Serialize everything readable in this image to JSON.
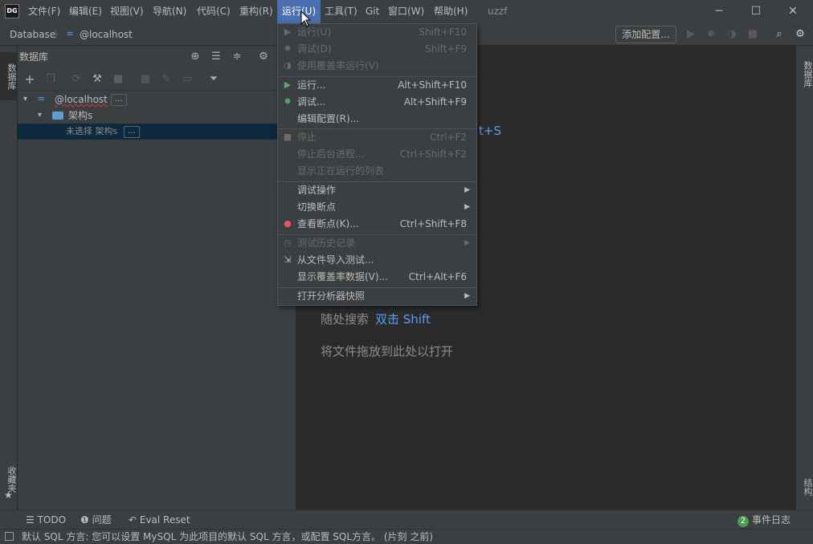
{
  "app": {
    "logo": "DG",
    "project": "uzzf"
  },
  "menu": [
    "文件(F)",
    "编辑(E)",
    "视图(V)",
    "导航(N)",
    "代码(C)",
    "重构(R)",
    "运行(U)",
    "工具(T)",
    "Git",
    "窗口(W)",
    "帮助(H)"
  ],
  "window_controls": {
    "minimize": "─",
    "maximize": "☐",
    "close": "✕"
  },
  "breadcrumb": {
    "root": "Database",
    "sep": "〉",
    "item": "@localhost"
  },
  "toolbar": {
    "add_config": "添加配置..."
  },
  "left_tabs": {
    "database": "数据库",
    "favorites": "收藏夹"
  },
  "right_tabs": {
    "database": "数据库",
    "structure": "结构"
  },
  "db_panel": {
    "title": "数据库"
  },
  "tree": {
    "host": "@localhost",
    "host_more": "...",
    "schemas": "架构s",
    "unselected": "未选择 架构s",
    "unselected_more": "..."
  },
  "editor": {
    "shortcut_fragment": "t+S",
    "search_label": "随处搜索",
    "search_key": "双击 Shift",
    "drop_label": "将文件拖放到此处以打开"
  },
  "run_menu": [
    {
      "label": "运行(U)",
      "shortcut": "Shift+F10",
      "disabled": true,
      "icon": "run-icon"
    },
    {
      "label": "调试(D)",
      "shortcut": "Shift+F9",
      "disabled": true,
      "icon": "debug-icon"
    },
    {
      "label": "使用覆盖率运行(V)",
      "shortcut": "",
      "disabled": true,
      "icon": "coverage-icon"
    },
    {
      "label": "运行...",
      "shortcut": "Alt+Shift+F10",
      "disabled": false,
      "icon": "run-icon"
    },
    {
      "label": "调试...",
      "shortcut": "Alt+Shift+F9",
      "disabled": false,
      "icon": "debug-icon"
    },
    {
      "label": "编辑配置(R)...",
      "shortcut": "",
      "disabled": false,
      "icon": ""
    },
    {
      "label": "停止",
      "shortcut": "Ctrl+F2",
      "disabled": true,
      "icon": "stop-icon"
    },
    {
      "label": "停止后台进程...",
      "shortcut": "Ctrl+Shift+F2",
      "disabled": true,
      "icon": ""
    },
    {
      "label": "显示正在运行的列表",
      "shortcut": "",
      "disabled": true,
      "icon": ""
    },
    {
      "label": "调试操作",
      "shortcut": "",
      "disabled": false,
      "icon": "",
      "submenu": true
    },
    {
      "label": "切换断点",
      "shortcut": "",
      "disabled": false,
      "icon": "",
      "submenu": true
    },
    {
      "label": "查看断点(K)...",
      "shortcut": "Ctrl+Shift+F8",
      "disabled": false,
      "icon": "breakpoints-icon"
    },
    {
      "label": "测试历史记录",
      "shortcut": "",
      "disabled": true,
      "icon": "history-icon",
      "submenu": true
    },
    {
      "label": "从文件导入测试...",
      "shortcut": "",
      "disabled": false,
      "icon": "import-icon"
    },
    {
      "label": "显示覆盖率数据(V)...",
      "shortcut": "Ctrl+Alt+F6",
      "disabled": false,
      "icon": ""
    },
    {
      "label": "打开分析器快照",
      "shortcut": "",
      "disabled": false,
      "icon": "",
      "submenu": true
    }
  ],
  "bottom_tools": {
    "todo": "TODO",
    "problems": "问题",
    "eval_reset": "Eval Reset",
    "event_log": "事件日志",
    "event_count": "2"
  },
  "status": {
    "text": "默认 SQL 方言: 您可以设置 MySQL 为此项目的默认 SQL 方言，或配置 SQL方言。 (片刻 之前)"
  },
  "colors": {
    "accent": "#4b6eaf",
    "run_green": "#59a869",
    "breakpoint_red": "#db5c5c",
    "link_blue": "#589df6"
  }
}
